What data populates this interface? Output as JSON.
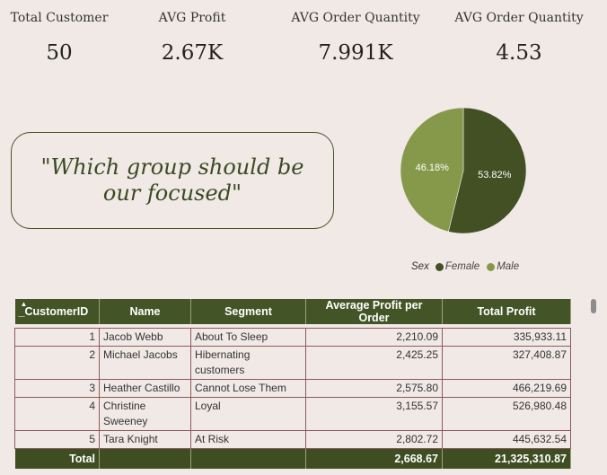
{
  "kpis": [
    {
      "label": "Total Customer",
      "value": "50"
    },
    {
      "label": "AVG Profit",
      "value": "2.67K"
    },
    {
      "label": "AVG Order Quantity",
      "value": "7.991K"
    },
    {
      "label": "AVG Order Quantity",
      "value": "4.53"
    }
  ],
  "quote": "\"Which group should be our focused\"",
  "pie": {
    "colors": {
      "female": "#425024",
      "male": "#86994a"
    },
    "legend_title": "Sex",
    "slices": [
      {
        "name": "Female",
        "value": 53.82,
        "label": "53.82%"
      },
      {
        "name": "Male",
        "value": 46.18,
        "label": "46.18%"
      }
    ]
  },
  "table": {
    "columns": [
      "_CustomerID",
      "Name",
      "Segment",
      "Average Profit per Order",
      "Total Profit"
    ],
    "rows": [
      {
        "id": "1",
        "name": "Jacob Webb",
        "segment": "About To Sleep",
        "avg": "2,210.09",
        "total": "335,933.11"
      },
      {
        "id": "2",
        "name": "Michael Jacobs",
        "segment": "Hibernating customers",
        "avg": "2,425.25",
        "total": "327,408.87"
      },
      {
        "id": "3",
        "name": "Heather Castillo",
        "segment": "Cannot Lose Them",
        "avg": "2,575.80",
        "total": "466,219.69"
      },
      {
        "id": "4",
        "name": "Christine Sweeney",
        "segment": "Loyal",
        "avg": "3,155.57",
        "total": "526,980.48"
      },
      {
        "id": "5",
        "name": "Tara Knight",
        "segment": "At Risk",
        "avg": "2,802.72",
        "total": "445,632.54"
      }
    ],
    "total": {
      "label": "Total",
      "avg": "2,668.67",
      "total": "21,325,310.87"
    }
  }
}
